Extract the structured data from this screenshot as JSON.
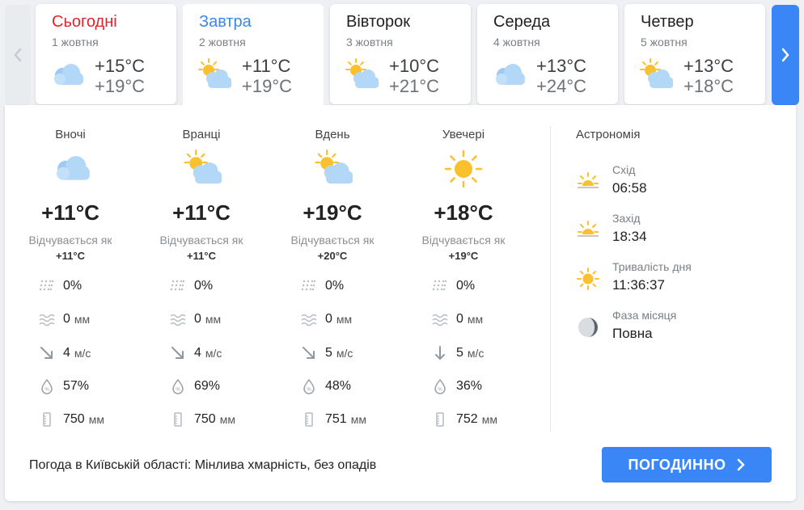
{
  "days": [
    {
      "name": "Сьогодні",
      "date": "1 жовтня",
      "tmin": "+15°C",
      "tmax": "+19°C",
      "icon": "cloudy-icon",
      "color": "#e0262b"
    },
    {
      "name": "Завтра",
      "date": "2 жовтня",
      "tmin": "+11°C",
      "tmax": "+19°C",
      "icon": "partly-cloudy-icon",
      "color": "#3b86f7"
    },
    {
      "name": "Вівторок",
      "date": "3 жовтня",
      "tmin": "+10°C",
      "tmax": "+21°C",
      "icon": "partly-cloudy-icon",
      "color": "#222222"
    },
    {
      "name": "Середа",
      "date": "4 жовтня",
      "tmin": "+13°C",
      "tmax": "+24°C",
      "icon": "cloudy-icon",
      "color": "#222222"
    },
    {
      "name": "Четвер",
      "date": "5 жовтня",
      "tmin": "+13°C",
      "tmax": "+18°C",
      "icon": "partly-cloudy-icon",
      "color": "#222222"
    }
  ],
  "periods": [
    {
      "title": "Вночі",
      "icon": "cloudy-icon",
      "temp": "+11°C",
      "feels_label": "Відчувається як",
      "feels": "+11°C",
      "precip_chance": "0%",
      "precip": "0",
      "precip_unit": "мм",
      "wind": "4",
      "wind_unit": "м/с",
      "wind_dir": "north-west",
      "humidity": "57%",
      "pressure": "750",
      "pressure_unit": "мм"
    },
    {
      "title": "Вранці",
      "icon": "partly-cloudy-icon",
      "temp": "+11°C",
      "feels_label": "Відчувається як",
      "feels": "+11°C",
      "precip_chance": "0%",
      "precip": "0",
      "precip_unit": "мм",
      "wind": "4",
      "wind_unit": "м/с",
      "wind_dir": "north-west",
      "humidity": "69%",
      "pressure": "750",
      "pressure_unit": "мм"
    },
    {
      "title": "Вдень",
      "icon": "partly-cloudy-icon",
      "temp": "+19°C",
      "feels_label": "Відчувається як",
      "feels": "+20°C",
      "precip_chance": "0%",
      "precip": "0",
      "precip_unit": "мм",
      "wind": "5",
      "wind_unit": "м/с",
      "wind_dir": "north-west",
      "humidity": "48%",
      "pressure": "751",
      "pressure_unit": "мм"
    },
    {
      "title": "Увечері",
      "icon": "sun-icon",
      "temp": "+18°C",
      "feels_label": "Відчувається як",
      "feels": "+19°C",
      "precip_chance": "0%",
      "precip": "0",
      "precip_unit": "мм",
      "wind": "5",
      "wind_unit": "м/с",
      "wind_dir": "north",
      "humidity": "36%",
      "pressure": "752",
      "pressure_unit": "мм"
    }
  ],
  "astronomy": {
    "title": "Астрономія",
    "sunrise_label": "Схід",
    "sunrise": "06:58",
    "sunset_label": "Захід",
    "sunset": "18:34",
    "daylength_label": "Тривалість дня",
    "daylength": "11:36:37",
    "moon_label": "Фаза місяця",
    "moon": "Повна"
  },
  "footer": {
    "text": "Погода в Київській області: Мінлива хмарність, без опадів",
    "button_label": "ПОГОДИННО"
  },
  "colors": {
    "accent": "#3b86f7",
    "today": "#e0262b",
    "sun": "#fbc02d",
    "cloud": "#90caf9"
  }
}
